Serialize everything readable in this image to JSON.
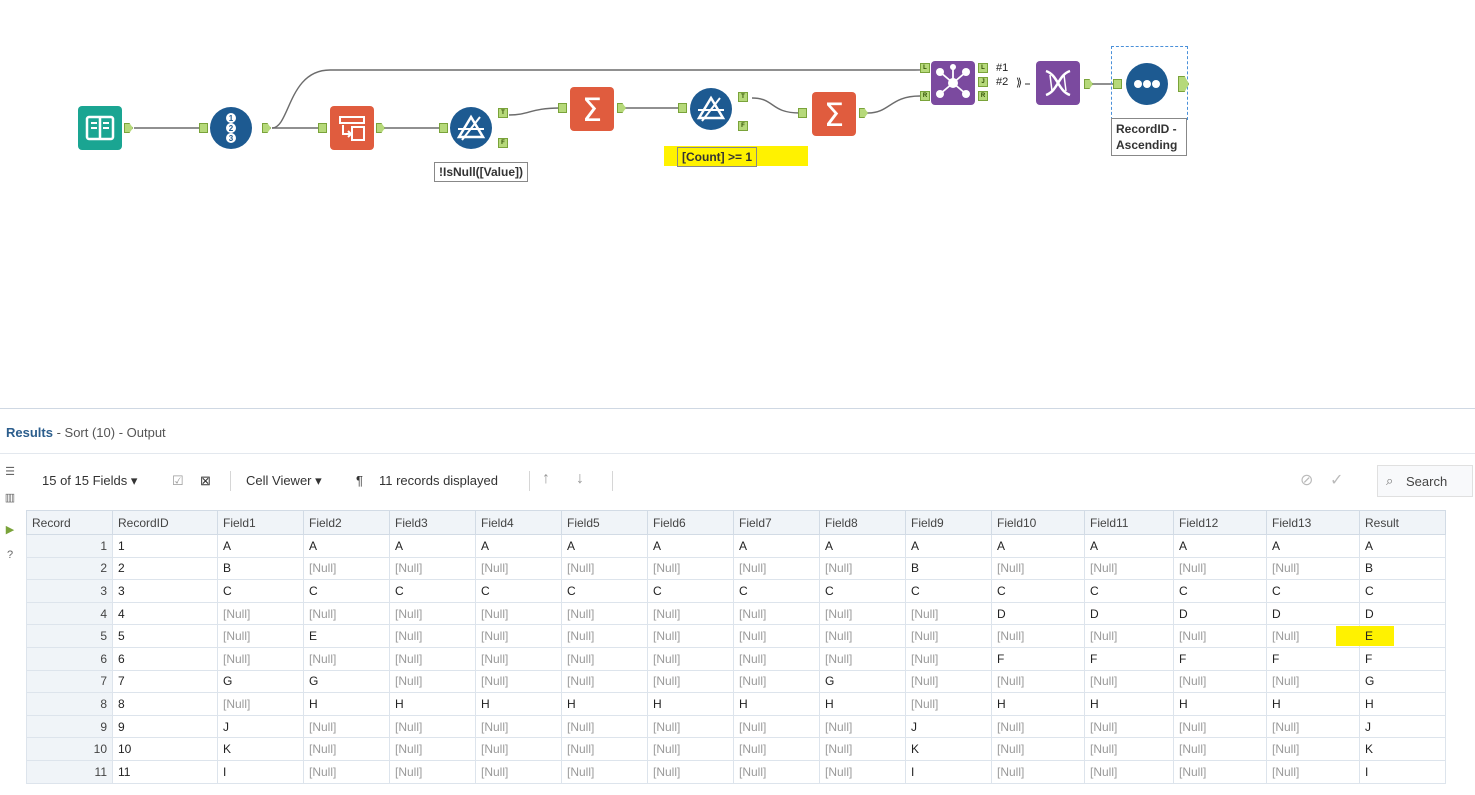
{
  "canvas": {
    "annotations": {
      "filter1": "!IsNull([Value])",
      "filter2": "[Count] >= 1",
      "sort": "RecordID -\nAscending"
    },
    "anchor_labels": {
      "true": "T",
      "false": "F",
      "left": "L",
      "join": "J",
      "right": "R"
    },
    "join_outputs": {
      "j1": "#1",
      "j2": "#2"
    },
    "tools": [
      "book-input-icon",
      "record-id-icon",
      "transpose-icon",
      "filter-icon",
      "summarize-icon",
      "filter-icon",
      "summarize-icon",
      "join-icon",
      "dna-icon",
      "browse-icon"
    ]
  },
  "results": {
    "title_bold": "Results",
    "title_rest": " - Sort (10) - Output",
    "toolbar": {
      "fields": "15 of 15 Fields",
      "cell_viewer": "Cell Viewer",
      "pilcrow": "¶",
      "records": "11 records displayed",
      "search": "Search"
    },
    "columns": [
      "Record",
      "RecordID",
      "Field1",
      "Field2",
      "Field3",
      "Field4",
      "Field5",
      "Field6",
      "Field7",
      "Field8",
      "Field9",
      "Field10",
      "Field11",
      "Field12",
      "Field13",
      "Result"
    ],
    "rows": [
      [
        "1",
        "1",
        "A",
        "A",
        "A",
        "A",
        "A",
        "A",
        "A",
        "A",
        "A",
        "A",
        "A",
        "A",
        "A",
        "A"
      ],
      [
        "2",
        "2",
        "B",
        "[Null]",
        "[Null]",
        "[Null]",
        "[Null]",
        "[Null]",
        "[Null]",
        "[Null]",
        "B",
        "[Null]",
        "[Null]",
        "[Null]",
        "[Null]",
        "B"
      ],
      [
        "3",
        "3",
        "C",
        "C",
        "C",
        "C",
        "C",
        "C",
        "C",
        "C",
        "C",
        "C",
        "C",
        "C",
        "C",
        "C"
      ],
      [
        "4",
        "4",
        "[Null]",
        "[Null]",
        "[Null]",
        "[Null]",
        "[Null]",
        "[Null]",
        "[Null]",
        "[Null]",
        "[Null]",
        "D",
        "D",
        "D",
        "D",
        "D"
      ],
      [
        "5",
        "5",
        "[Null]",
        "E",
        "[Null]",
        "[Null]",
        "[Null]",
        "[Null]",
        "[Null]",
        "[Null]",
        "[Null]",
        "[Null]",
        "[Null]",
        "[Null]",
        "[Null]",
        "E"
      ],
      [
        "6",
        "6",
        "[Null]",
        "[Null]",
        "[Null]",
        "[Null]",
        "[Null]",
        "[Null]",
        "[Null]",
        "[Null]",
        "[Null]",
        "F",
        "F",
        "F",
        "F",
        "F"
      ],
      [
        "7",
        "7",
        "G",
        "G",
        "[Null]",
        "[Null]",
        "[Null]",
        "[Null]",
        "[Null]",
        "G",
        "[Null]",
        "[Null]",
        "[Null]",
        "[Null]",
        "[Null]",
        "G"
      ],
      [
        "8",
        "8",
        "[Null]",
        "H",
        "H",
        "H",
        "H",
        "H",
        "H",
        "H",
        "[Null]",
        "H",
        "H",
        "H",
        "H",
        "H"
      ],
      [
        "9",
        "9",
        "J",
        "[Null]",
        "[Null]",
        "[Null]",
        "[Null]",
        "[Null]",
        "[Null]",
        "[Null]",
        "J",
        "[Null]",
        "[Null]",
        "[Null]",
        "[Null]",
        "J"
      ],
      [
        "10",
        "10",
        "K",
        "[Null]",
        "[Null]",
        "[Null]",
        "[Null]",
        "[Null]",
        "[Null]",
        "[Null]",
        "K",
        "[Null]",
        "[Null]",
        "[Null]",
        "[Null]",
        "K"
      ],
      [
        "11",
        "11",
        "I",
        "[Null]",
        "[Null]",
        "[Null]",
        "[Null]",
        "[Null]",
        "[Null]",
        "[Null]",
        "I",
        "[Null]",
        "[Null]",
        "[Null]",
        "[Null]",
        "I"
      ]
    ],
    "highlighted_cell": {
      "row": 4,
      "col": 15
    },
    "column_widths": [
      86,
      105,
      86,
      86,
      86,
      86,
      86,
      86,
      86,
      86,
      86,
      93,
      89,
      93,
      93,
      86
    ]
  },
  "colors": {
    "input": "#1aa592",
    "recordid": "#1d5a91",
    "transpose": "#e05c3e",
    "filter": "#1d5a91",
    "summarize": "#e05c3e",
    "join": "#7b4a9f",
    "dna": "#7b4a9f",
    "browse": "#1d5a91",
    "highlight": "#fff200"
  }
}
